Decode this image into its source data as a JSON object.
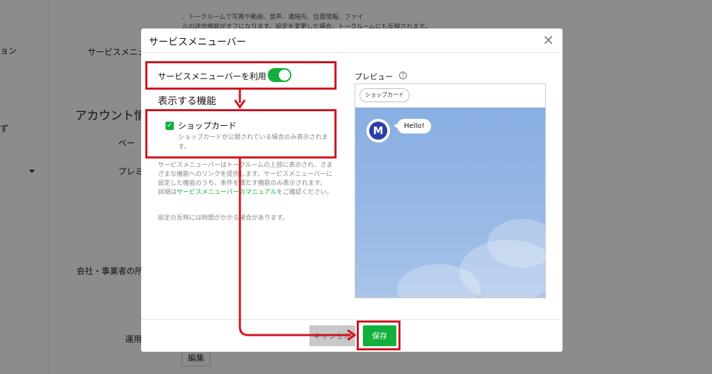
{
  "background": {
    "labels": [
      "ョン",
      "サービスメニュ",
      "アカウント情",
      "ペー",
      "プレミ",
      "会社・事業者の所",
      "運用"
    ],
    "side_glyph": "ず",
    "note_line1": "、トークルームで写真や動画、音声、連絡先、位置情報、ファイ",
    "note_line2": "ルの送信機能がオフになります。設定を変更した場合、トークルームにも反映されます。",
    "edit_button": "編集"
  },
  "modal": {
    "title": "サービスメニューバー",
    "close": "×",
    "toggle_label": "サービスメニューバーを利用",
    "toggle_on": true,
    "features_title": "表示する機能",
    "checkbox_label": "ショップカード",
    "checkbox_checked": true,
    "checkbox_desc": "ショップカードが公開されている場合のみ表示されます。",
    "help_text_1": "サービスメニューバーはトークルームの上部に表示され、さまざまな機能へのリンクを提供します。サービスメニューバーに設定した機能のうち、条件を満たす機能のみ表示されます。",
    "help_prefix": "詳細は",
    "help_link": "サービスメニューバーのマニュアル",
    "help_suffix": "をご確認ください。",
    "help_note": "設定の反映には時間がかかる場合があります。",
    "preview_label": "プレビュー",
    "help_icon": "?",
    "preview_chip": "ショップカード",
    "avatar_letter": "M",
    "bubble_text": "Hello!",
    "cancel_button": "キャンセル",
    "save_button": "保存"
  },
  "colors": {
    "accent_green": "#12b03c",
    "highlight_red": "#d0141e",
    "chat_bg": "#89aee2",
    "avatar_blue": "#2a3ea6"
  }
}
